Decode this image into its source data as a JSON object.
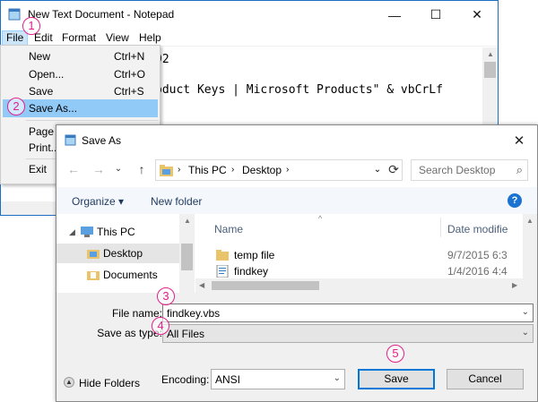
{
  "notepad": {
    "title": "New Text Document - Notepad",
    "window_controls": {
      "minimize": "—",
      "maximize": "☐",
      "close": "✕"
    },
    "menus": [
      "File",
      "Edit",
      "Format",
      "View",
      "Help"
    ],
    "text_lines": [
      "92",
      "oduct Keys | Microsoft Products\" & vbCrLf"
    ]
  },
  "file_menu": {
    "items": [
      {
        "label": "New",
        "shortcut": "Ctrl+N"
      },
      {
        "label": "Open...",
        "shortcut": "Ctrl+O"
      },
      {
        "label": "Save",
        "shortcut": "Ctrl+S"
      },
      {
        "label": "Save As...",
        "shortcut": ""
      },
      {
        "label": "Page Se",
        "shortcut": ""
      },
      {
        "label": "Print...",
        "shortcut": ""
      },
      {
        "label": "Exit",
        "shortcut": ""
      }
    ]
  },
  "save_as": {
    "title": "Save As",
    "close": "✕",
    "nav": {
      "back": "←",
      "forward": "→",
      "recent": "⌄",
      "up": "↑"
    },
    "breadcrumb": [
      "This PC",
      "Desktop"
    ],
    "breadcrumb_sep": "›",
    "refresh": "⟳",
    "search_placeholder": "Search Desktop",
    "search_icon": "⌕",
    "organize": "Organize ▾",
    "new_folder": "New folder",
    "help": "?",
    "nav_pane": [
      "This PC",
      "Desktop",
      "Documents"
    ],
    "columns": {
      "name": "Name",
      "date": "Date modifie"
    },
    "files": [
      {
        "name": "temp file",
        "date": "9/7/2015 6:3",
        "icon": "folder-icon"
      },
      {
        "name": "findkey",
        "date": "1/4/2016 4:4",
        "icon": "script-icon"
      }
    ],
    "file_name_label": "File name:",
    "file_name_value": "findkey.vbs",
    "save_type_label": "Save as type:",
    "save_type_value": "All Files",
    "hide_folders": "Hide Folders",
    "encoding_label": "Encoding:",
    "encoding_value": "ANSI",
    "save_button": "Save",
    "cancel_button": "Cancel"
  },
  "steps": [
    "1",
    "2",
    "3",
    "4",
    "5"
  ],
  "colors": {
    "step_marker": "#e0208a",
    "highlight": "#91c9f7",
    "accent": "#0078d7"
  }
}
